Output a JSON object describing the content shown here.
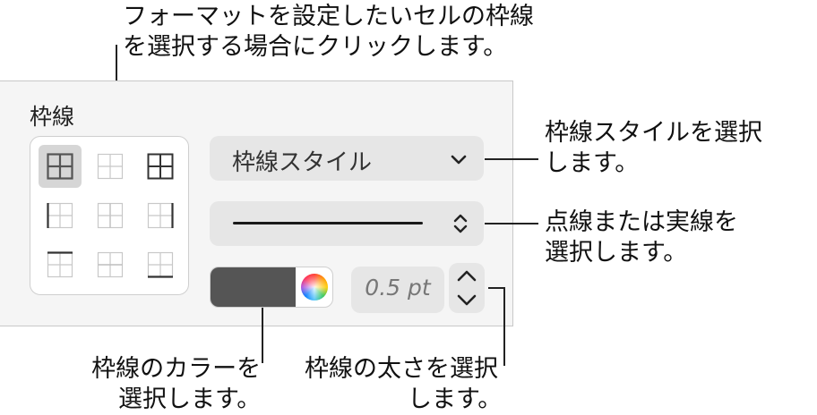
{
  "callouts": {
    "top": [
      "フォーマットを設定したいセルの枠線",
      "を選択する場合にクリックします。"
    ],
    "style": [
      "枠線スタイルを選択",
      "します。"
    ],
    "line": [
      "点線または実線を",
      "選択します。"
    ],
    "color": [
      "枠線のカラーを",
      "選択します。"
    ],
    "thickness": [
      "枠線の太さを選択",
      "します。"
    ]
  },
  "panel": {
    "title": "枠線",
    "border_style_label": "枠線スタイル",
    "thickness_value": "0.5 pt",
    "color_swatch": "#555555",
    "border_buttons": [
      {
        "name": "all-borders-icon",
        "selected": true
      },
      {
        "name": "inner-borders-icon",
        "selected": false
      },
      {
        "name": "outer-borders-icon",
        "selected": false
      },
      {
        "name": "left-border-icon",
        "selected": false
      },
      {
        "name": "inner-vertical-icon",
        "selected": false
      },
      {
        "name": "right-border-icon",
        "selected": false
      },
      {
        "name": "top-border-icon",
        "selected": false
      },
      {
        "name": "inner-horizontal-icon",
        "selected": false
      },
      {
        "name": "bottom-border-icon",
        "selected": false
      }
    ]
  },
  "colors": {
    "panel_bg": "#f5f5f5",
    "control_bg": "#e6e6e6",
    "selected_bg": "#d6d6d6",
    "swatch": "#555555"
  }
}
